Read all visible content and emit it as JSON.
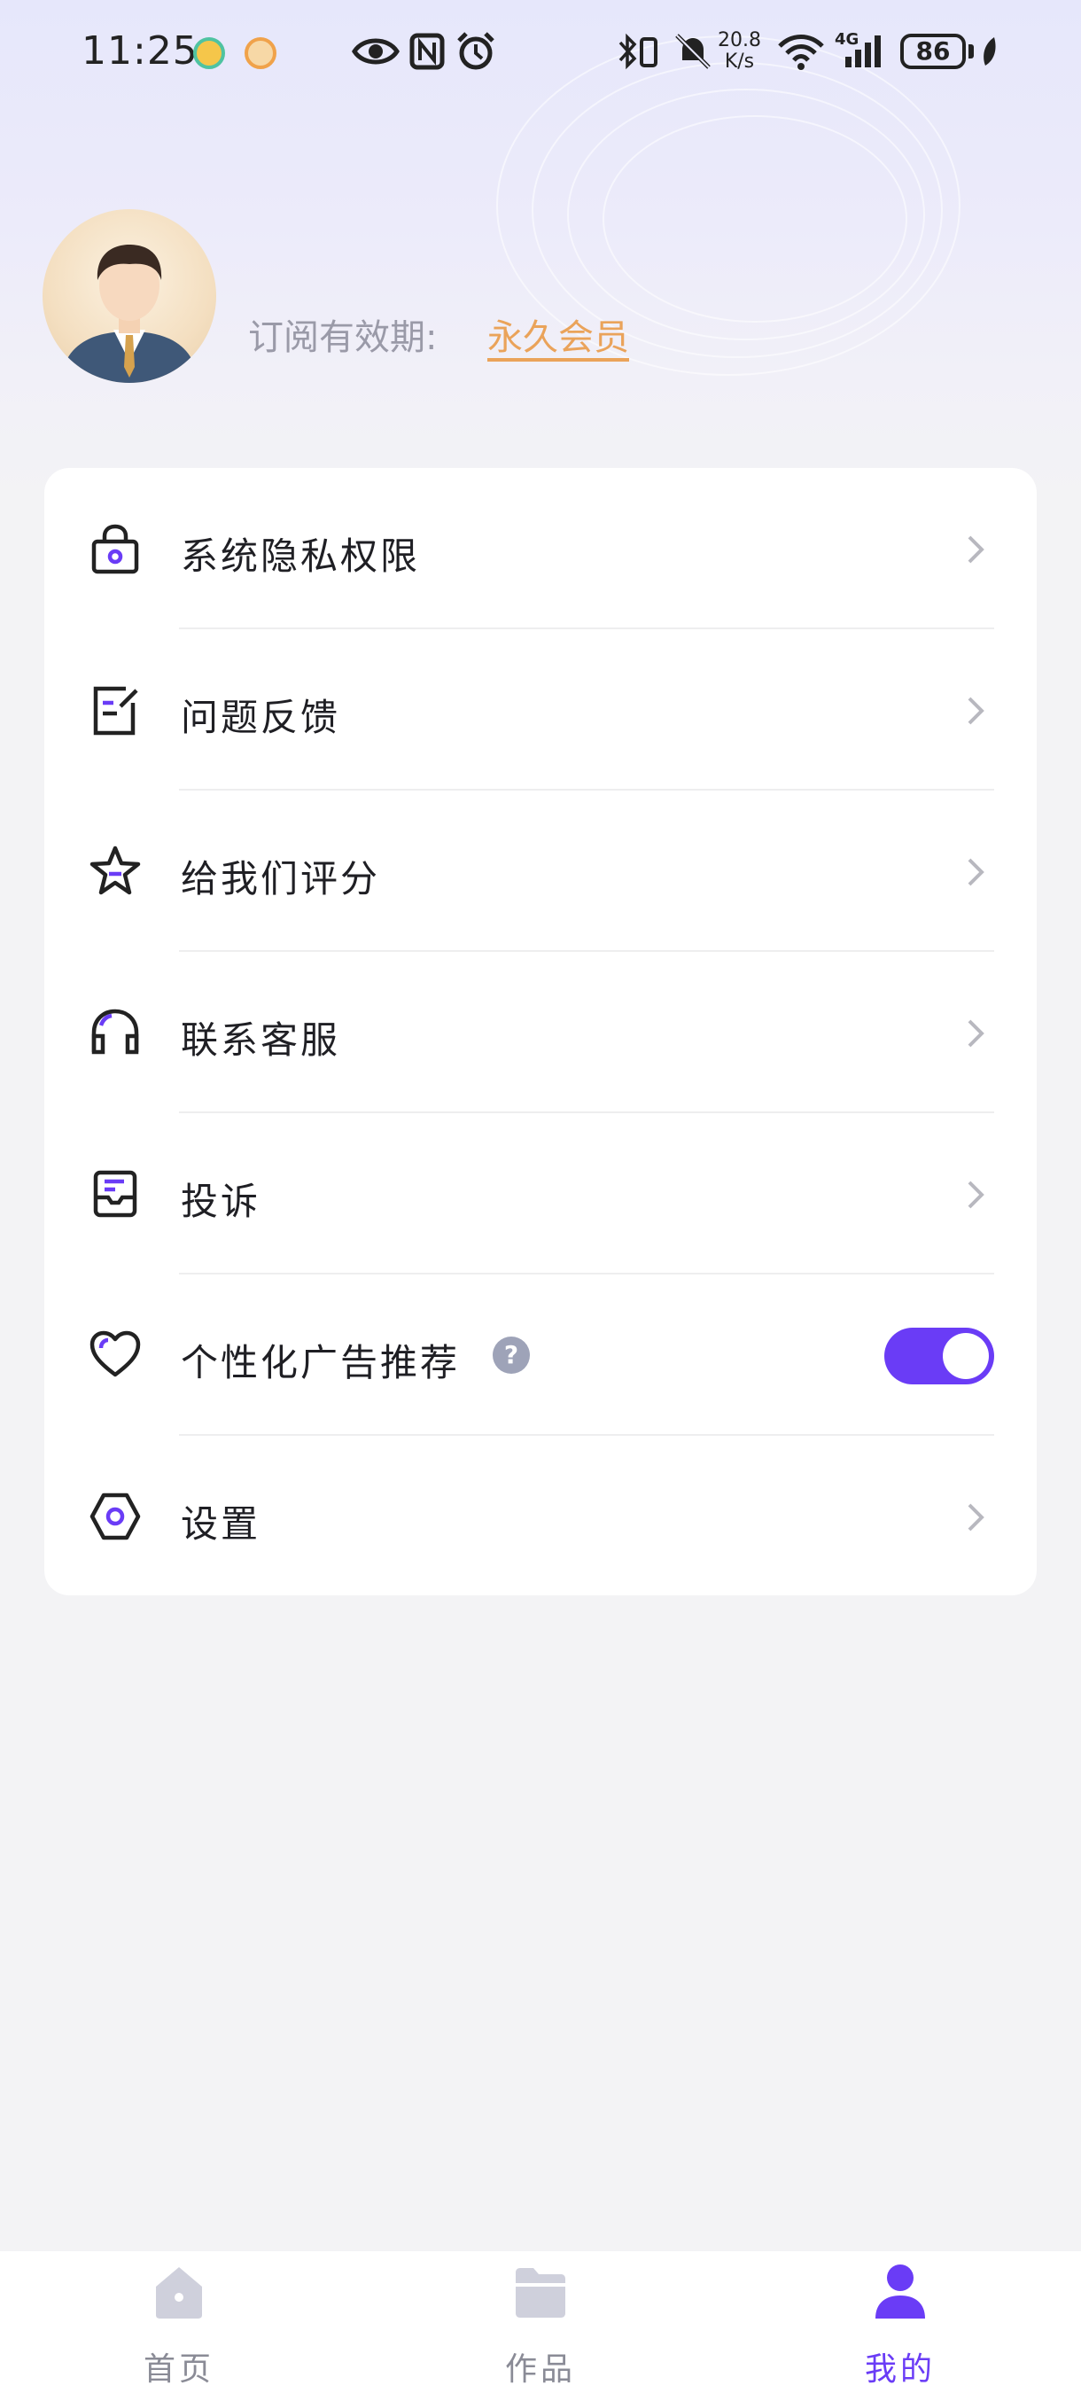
{
  "status_bar": {
    "time": "11:25",
    "speed_value": "20.8",
    "speed_unit": "K/s",
    "network": "4G",
    "battery": "86"
  },
  "profile": {
    "subscription_label": "订阅有效期:",
    "subscription_value": "永久会员"
  },
  "menu": {
    "items": [
      {
        "label": "系统隐私权限",
        "icon": "lock-icon"
      },
      {
        "label": "问题反馈",
        "icon": "feedback-icon"
      },
      {
        "label": "给我们评分",
        "icon": "star-icon"
      },
      {
        "label": "联系客服",
        "icon": "headset-icon"
      },
      {
        "label": "投诉",
        "icon": "complaint-icon"
      },
      {
        "label": "个性化广告推荐",
        "icon": "heart-icon",
        "help": "?",
        "toggle": true
      },
      {
        "label": "设置",
        "icon": "settings-icon"
      }
    ]
  },
  "bottom_nav": {
    "items": [
      {
        "label": "首页",
        "icon": "home-icon"
      },
      {
        "label": "作品",
        "icon": "folder-icon"
      },
      {
        "label": "我的",
        "icon": "user-icon"
      }
    ],
    "active": "我的"
  },
  "colors": {
    "accent": "#6a3cf6",
    "subscription": "#eaa35a",
    "background": "#f3f3f5"
  }
}
